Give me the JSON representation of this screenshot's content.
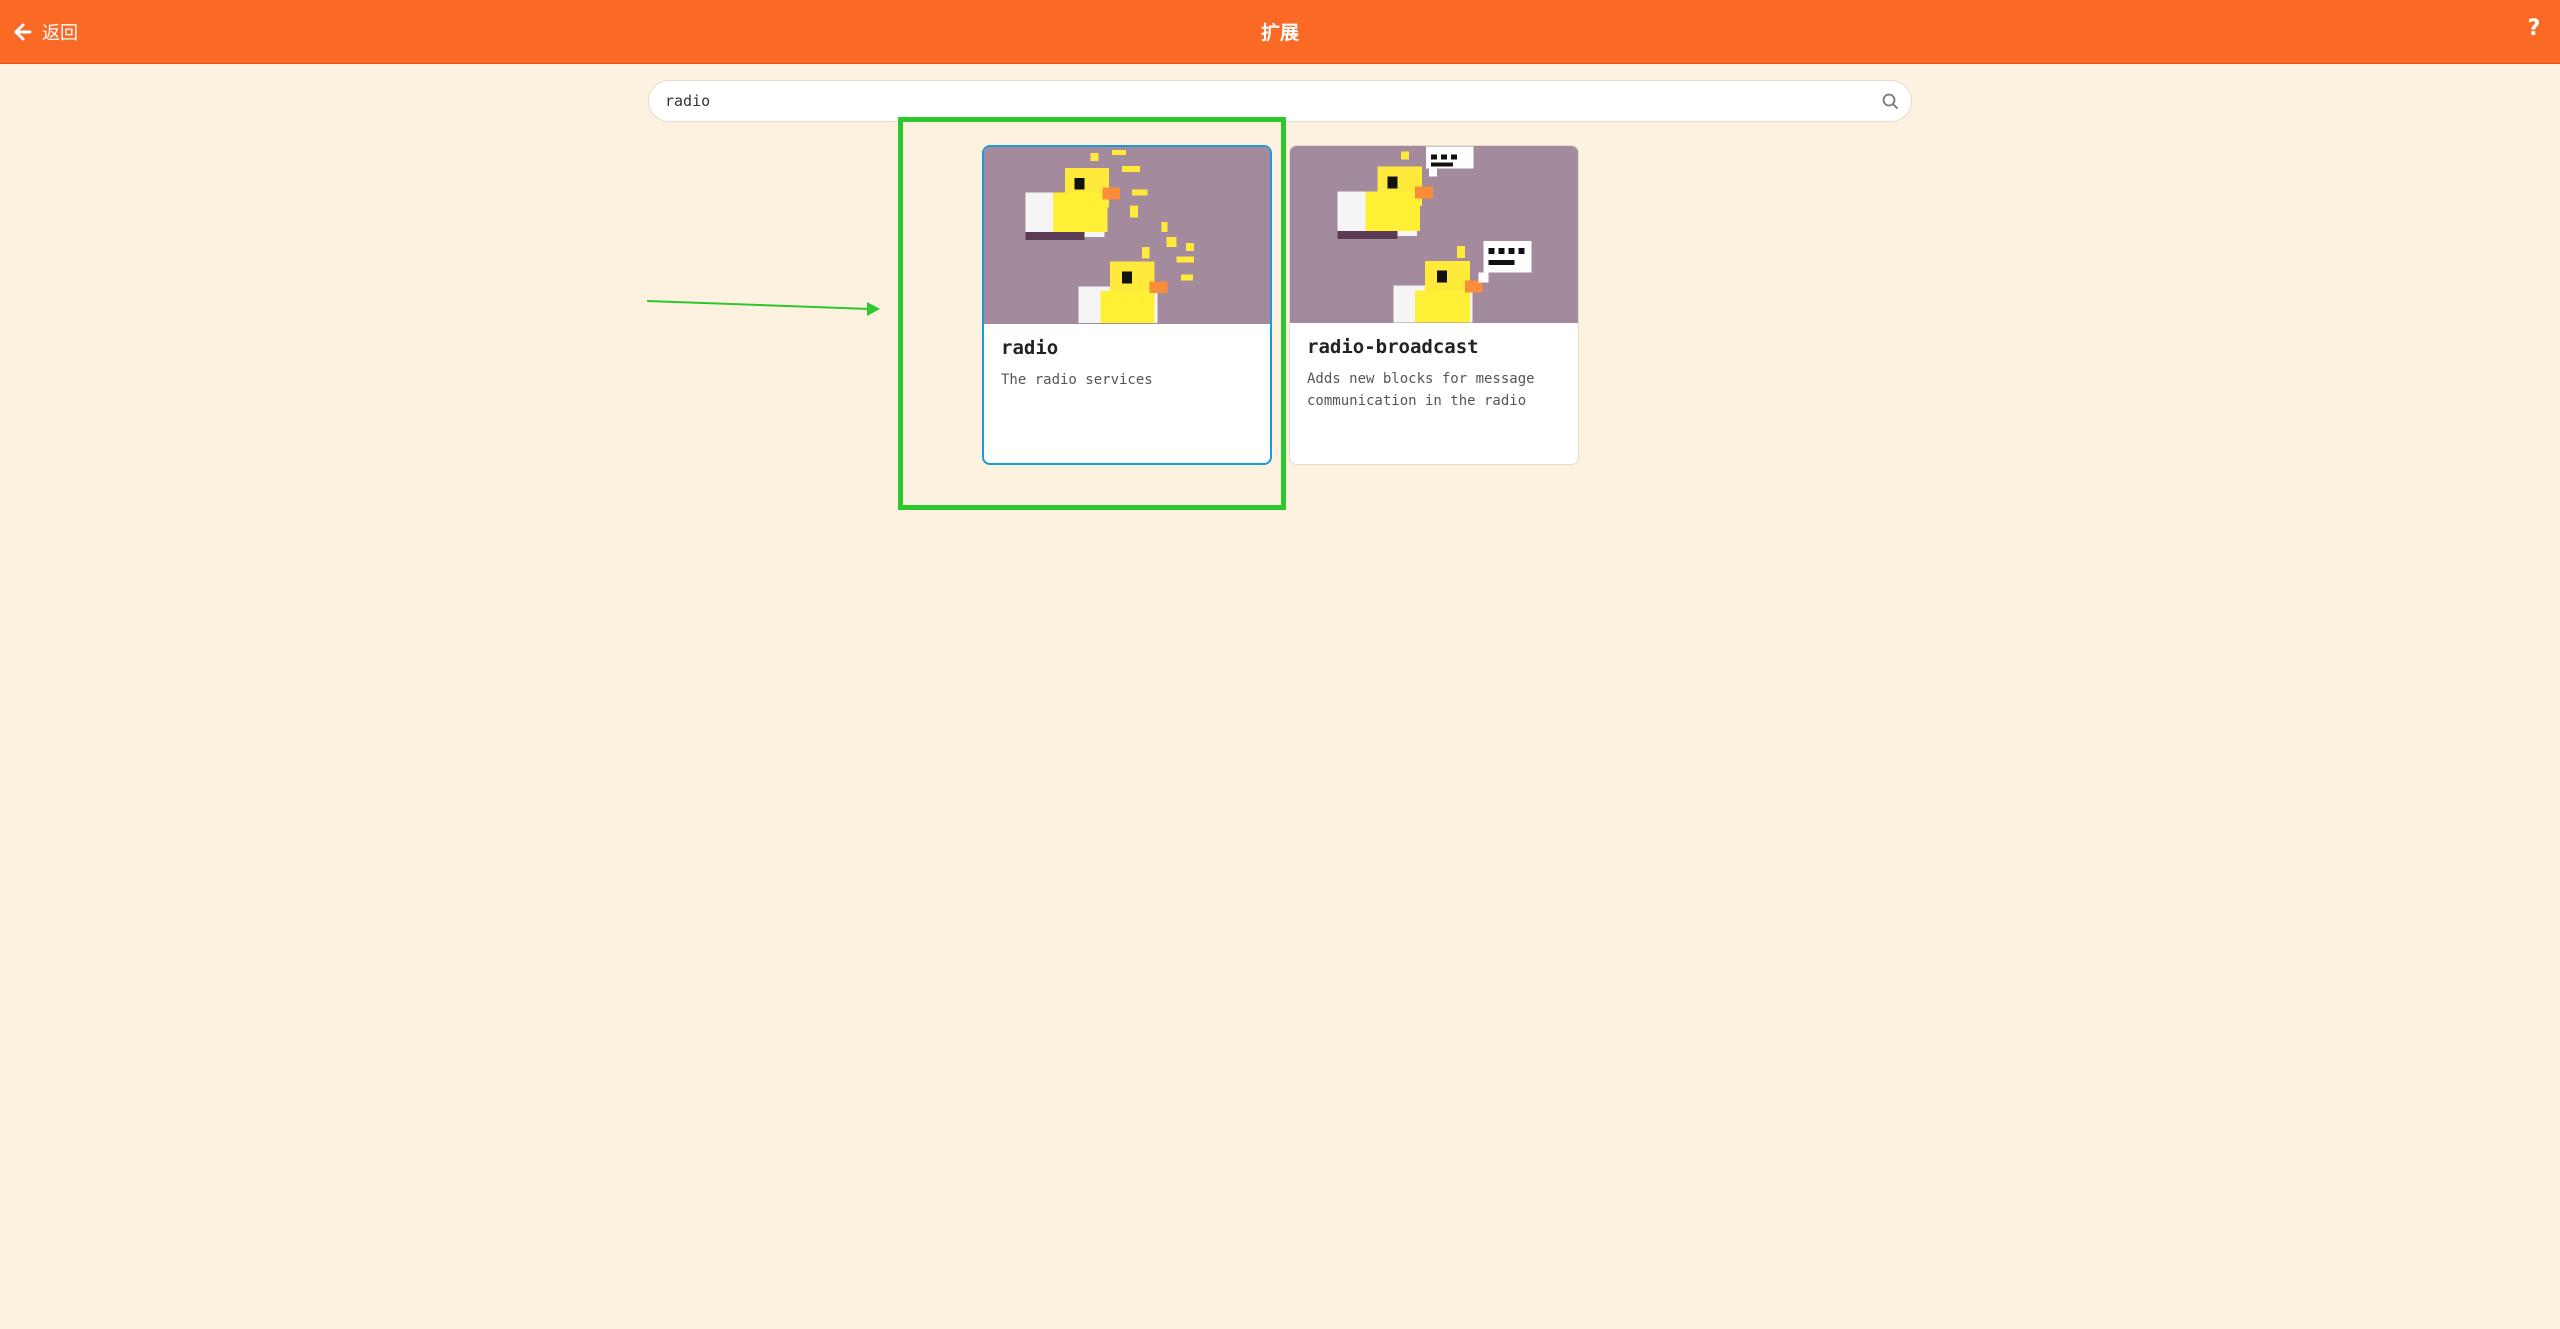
{
  "header": {
    "back_label": "返回",
    "title": "扩展",
    "help_label": "?",
    "bg_color": "#fb6a25"
  },
  "search": {
    "value": "radio",
    "icon": "search-icon"
  },
  "cards": [
    {
      "title": "radio",
      "description": "The radio services",
      "selected": true
    },
    {
      "title": "radio-broadcast",
      "description": "Adds new blocks for message communication in the radio",
      "selected": false
    }
  ],
  "annotation": {
    "highlight_color": "#2ec72e"
  }
}
